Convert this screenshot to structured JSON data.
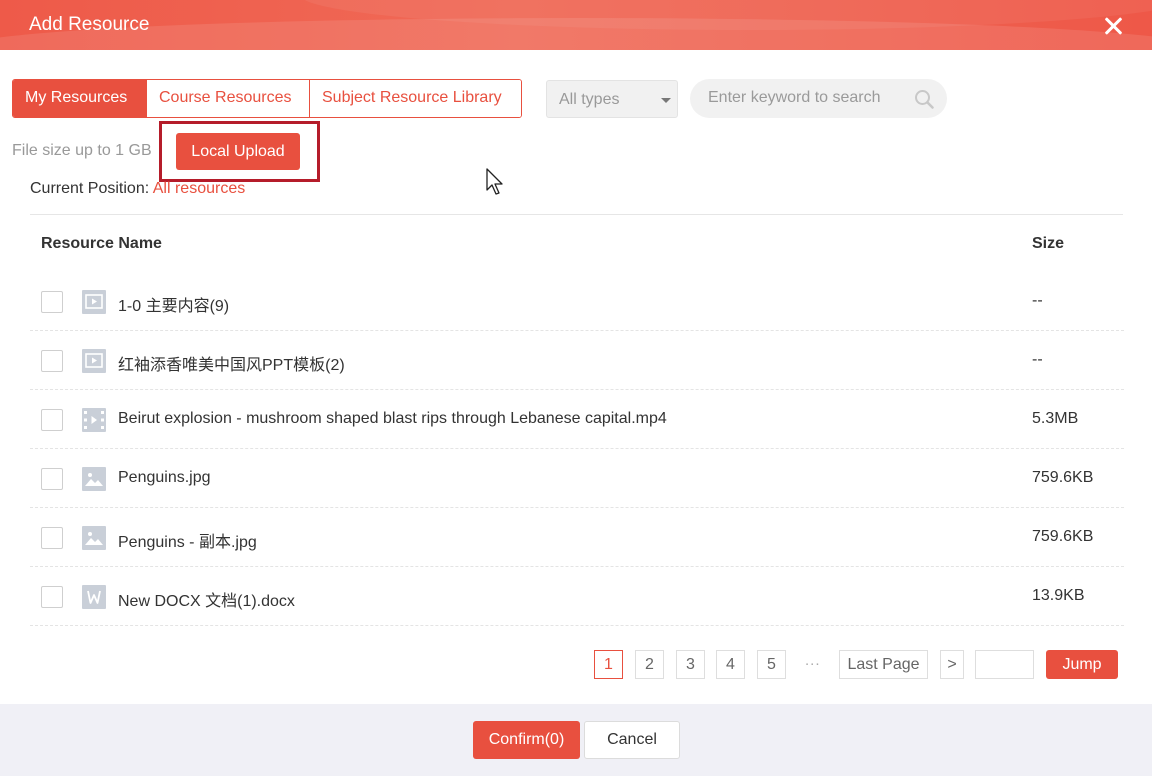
{
  "dialog": {
    "title": "Add Resource"
  },
  "tabs": [
    {
      "label": "My Resources",
      "active": true
    },
    {
      "label": "Course Resources",
      "active": false
    },
    {
      "label": "Subject Resource Library",
      "active": false
    }
  ],
  "filter": {
    "type_selected": "All types"
  },
  "search": {
    "placeholder": "Enter keyword to search"
  },
  "upload": {
    "limit_text": "File size up to 1 GB",
    "button_label": "Local Upload"
  },
  "breadcrumb": {
    "label": "Current Position: ",
    "current": "All resources"
  },
  "table": {
    "headers": {
      "name": "Resource Name",
      "size": "Size"
    },
    "rows": [
      {
        "icon": "folder-video-icon",
        "name": "1-0 主要内容(9)",
        "size": "--"
      },
      {
        "icon": "folder-video-icon",
        "name": "红袖添香唯美中国风PPT模板(2)",
        "size": "--"
      },
      {
        "icon": "video-file-icon",
        "name": "Beirut explosion - mushroom shaped blast rips through Lebanese capital.mp4",
        "size": "5.3MB"
      },
      {
        "icon": "image-file-icon",
        "name": "Penguins.jpg",
        "size": "759.6KB"
      },
      {
        "icon": "image-file-icon",
        "name": "Penguins - 副本.jpg",
        "size": "759.6KB"
      },
      {
        "icon": "word-file-icon",
        "name": "New DOCX 文档(1).docx",
        "size": "13.9KB"
      }
    ]
  },
  "pagination": {
    "pages": [
      "1",
      "2",
      "3",
      "4",
      "5"
    ],
    "current": "1",
    "ellipsis": "...",
    "last_label": "Last Page",
    "next_label": ">",
    "jump_label": "Jump"
  },
  "footer": {
    "confirm_label": "Confirm(0)",
    "cancel_label": "Cancel"
  },
  "colors": {
    "accent": "#e8503f",
    "highlight_box": "#b51c2a",
    "footer_bg": "#f0f0f6"
  }
}
